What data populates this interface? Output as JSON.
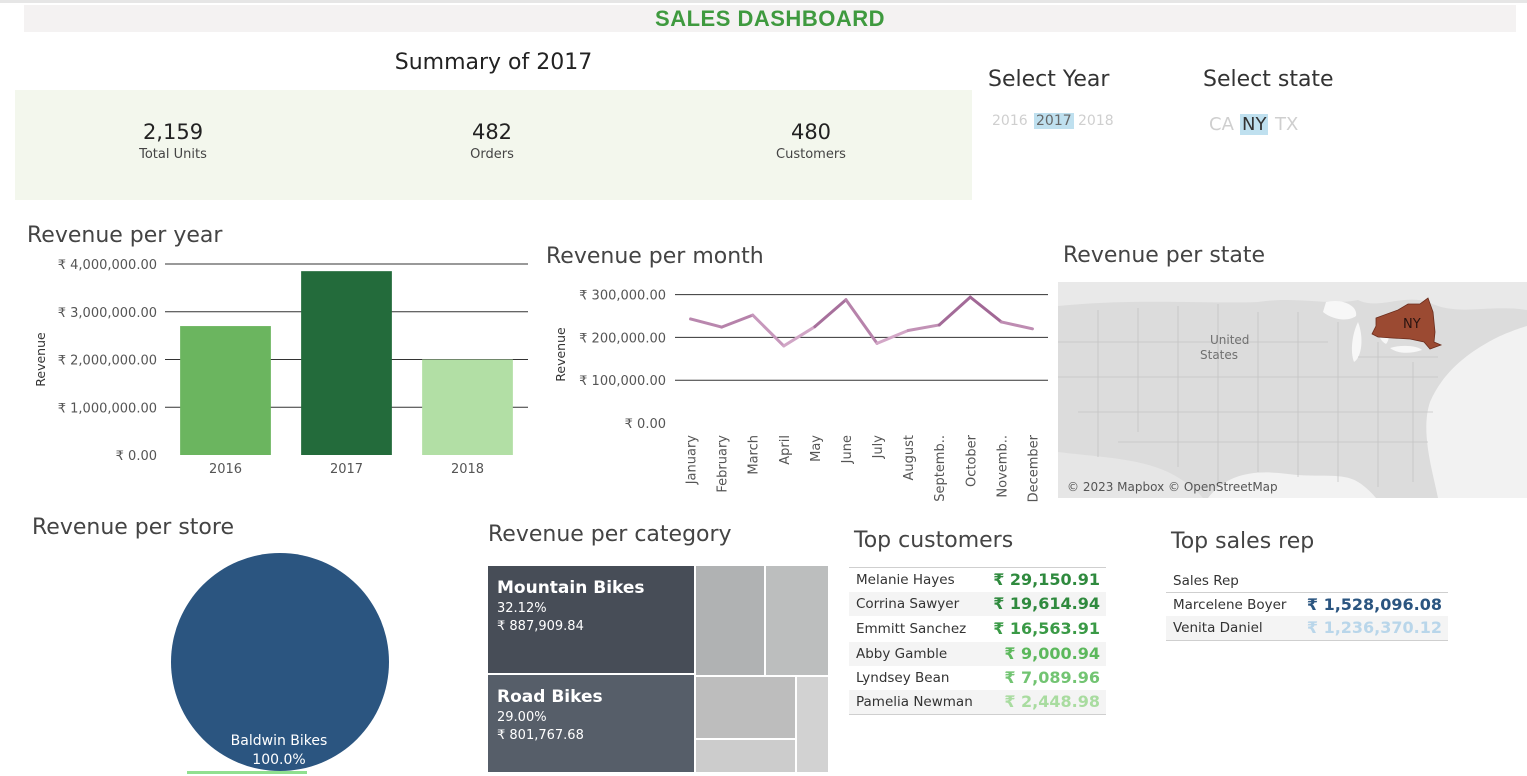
{
  "dashboard": {
    "title": "SALES DASHBOARD"
  },
  "summary": {
    "title": "Summary of 2017",
    "kpis": [
      {
        "value": "2,159",
        "label": "Total Units"
      },
      {
        "value": "482",
        "label": "Orders"
      },
      {
        "value": "480",
        "label": "Customers"
      }
    ]
  },
  "filters": {
    "year": {
      "title": "Select Year",
      "options": [
        "2016",
        "2017",
        "2018"
      ],
      "selected": "2017"
    },
    "state": {
      "title": "Select state",
      "options": [
        "CA",
        "NY",
        "TX"
      ],
      "selected": "NY"
    }
  },
  "sections": {
    "revenue_year": "Revenue per year",
    "revenue_month": "Revenue per month",
    "revenue_state": "Revenue per state",
    "revenue_store": "Revenue per store",
    "revenue_category": "Revenue per category",
    "top_customers": "Top customers",
    "top_sales_rep": "Top sales rep"
  },
  "map": {
    "country_label": "United States",
    "state_label": "NY",
    "attribution": "© 2023 Mapbox © OpenStreetMap",
    "highlight_color": "#9b4a32"
  },
  "pie": {
    "label": "Baldwin Bikes",
    "pct": "100.0%",
    "color": "#2b5580"
  },
  "treemap": {
    "tiles": [
      {
        "name": "Mountain Bikes",
        "pct": "32.12%",
        "value": "₹ 887,909.84"
      },
      {
        "name": "Road Bikes",
        "pct": "29.00%",
        "value": "₹ 801,767.68"
      }
    ]
  },
  "top_customers": [
    {
      "name": "Melanie Hayes",
      "value": "₹ 29,150.91",
      "color": "#2f8a3e"
    },
    {
      "name": "Corrina Sawyer",
      "value": "₹ 19,614.94",
      "color": "#2f8a3e"
    },
    {
      "name": "Emmitt Sanchez",
      "value": "₹ 16,563.91",
      "color": "#3a9a46"
    },
    {
      "name": "Abby Gamble",
      "value": "₹ 9,000.94",
      "color": "#5cb85c"
    },
    {
      "name": "Lyndsey Bean",
      "value": "₹ 7,089.96",
      "color": "#72c472"
    },
    {
      "name": "Pamelia Newman",
      "value": "₹ 2,448.98",
      "color": "#a9dca0"
    }
  ],
  "top_sales_rep": {
    "header": "Sales Rep",
    "rows": [
      {
        "name": "Marcelene Boyer",
        "value": "₹ 1,528,096.08",
        "color": "#2b5580"
      },
      {
        "name": "Venita Daniel",
        "value": "₹ 1,236,370.12",
        "color": "#b9d6ea"
      }
    ]
  },
  "chart_data": [
    {
      "type": "bar",
      "title": "Revenue per year",
      "ylabel": "Revenue",
      "categories": [
        "2016",
        "2017",
        "2018"
      ],
      "values": [
        2700000,
        3850000,
        2000000
      ],
      "colors": [
        "#6bb55f",
        "#236b3b",
        "#b2dfa5"
      ],
      "ylim": [
        0,
        4000000
      ],
      "y_ticks": [
        0,
        1000000,
        2000000,
        3000000,
        4000000
      ],
      "y_tick_labels": [
        "₹ 0.00",
        "₹ 1,000,000.00",
        "₹ 2,000,000.00",
        "₹ 3,000,000.00",
        "₹ 4,000,000.00"
      ]
    },
    {
      "type": "line",
      "title": "Revenue per month",
      "ylabel": "Revenue",
      "categories": [
        "January",
        "February",
        "March",
        "April",
        "May",
        "June",
        "July",
        "August",
        "Septemb..",
        "October",
        "Novemb..",
        "December"
      ],
      "values": [
        243000,
        224000,
        252000,
        180000,
        225000,
        288000,
        186000,
        216000,
        229000,
        294000,
        236000,
        220000
      ],
      "ylim": [
        0,
        320000
      ],
      "y_ticks": [
        0,
        100000,
        200000,
        300000
      ],
      "y_tick_labels": [
        "₹ 0.00",
        "₹ 100,000.00",
        "₹ 200,000.00",
        "₹ 300,000.00"
      ],
      "color_light": "#e3bcd8",
      "color_dark": "#8a4a7e"
    }
  ]
}
